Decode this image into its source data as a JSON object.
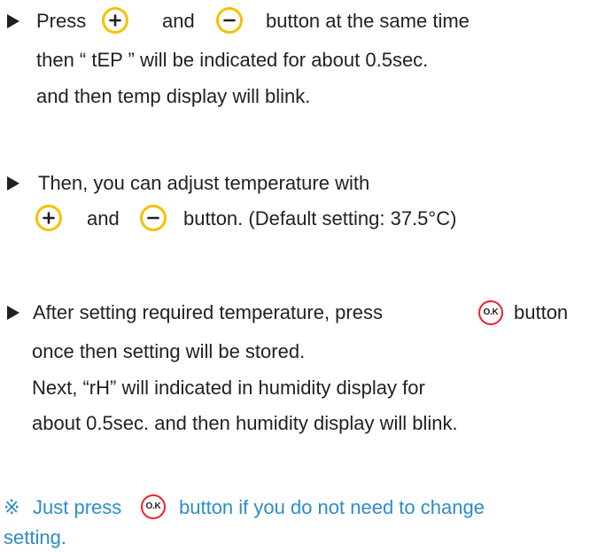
{
  "icons": {
    "bullet": "triangle-right-icon",
    "plus": "plus-button-icon",
    "minus": "minus-button-icon",
    "ok": "ok-button-icon",
    "ok_label": "O.K",
    "note_mark": "reference-mark"
  },
  "colors": {
    "text": "#231f20",
    "note": "#2e8cc8",
    "plus_minus_ring": "#f5c100",
    "ok_ring": "#e8232a"
  },
  "step1": {
    "press": "Press",
    "and": "and",
    "tail": "button at the same time",
    "line2": "then “ tEP ” will be indicated for about 0.5sec.",
    "line3": "and then temp display will blink."
  },
  "step2": {
    "line1": "Then, you can adjust temperature with",
    "and": "and",
    "tail": "button. (Default setting: 37.5°C)"
  },
  "step3": {
    "line1": "After setting required temperature, press",
    "tail": "button",
    "line2": "once then setting will be stored.",
    "line3": "Next, “rH” will indicated in humidity display for",
    "line4": "about 0.5sec. and then humidity display will blink."
  },
  "note": {
    "mark": "※",
    "lead": "Just press",
    "tail": "button if you do not need to change",
    "line2": "setting."
  }
}
